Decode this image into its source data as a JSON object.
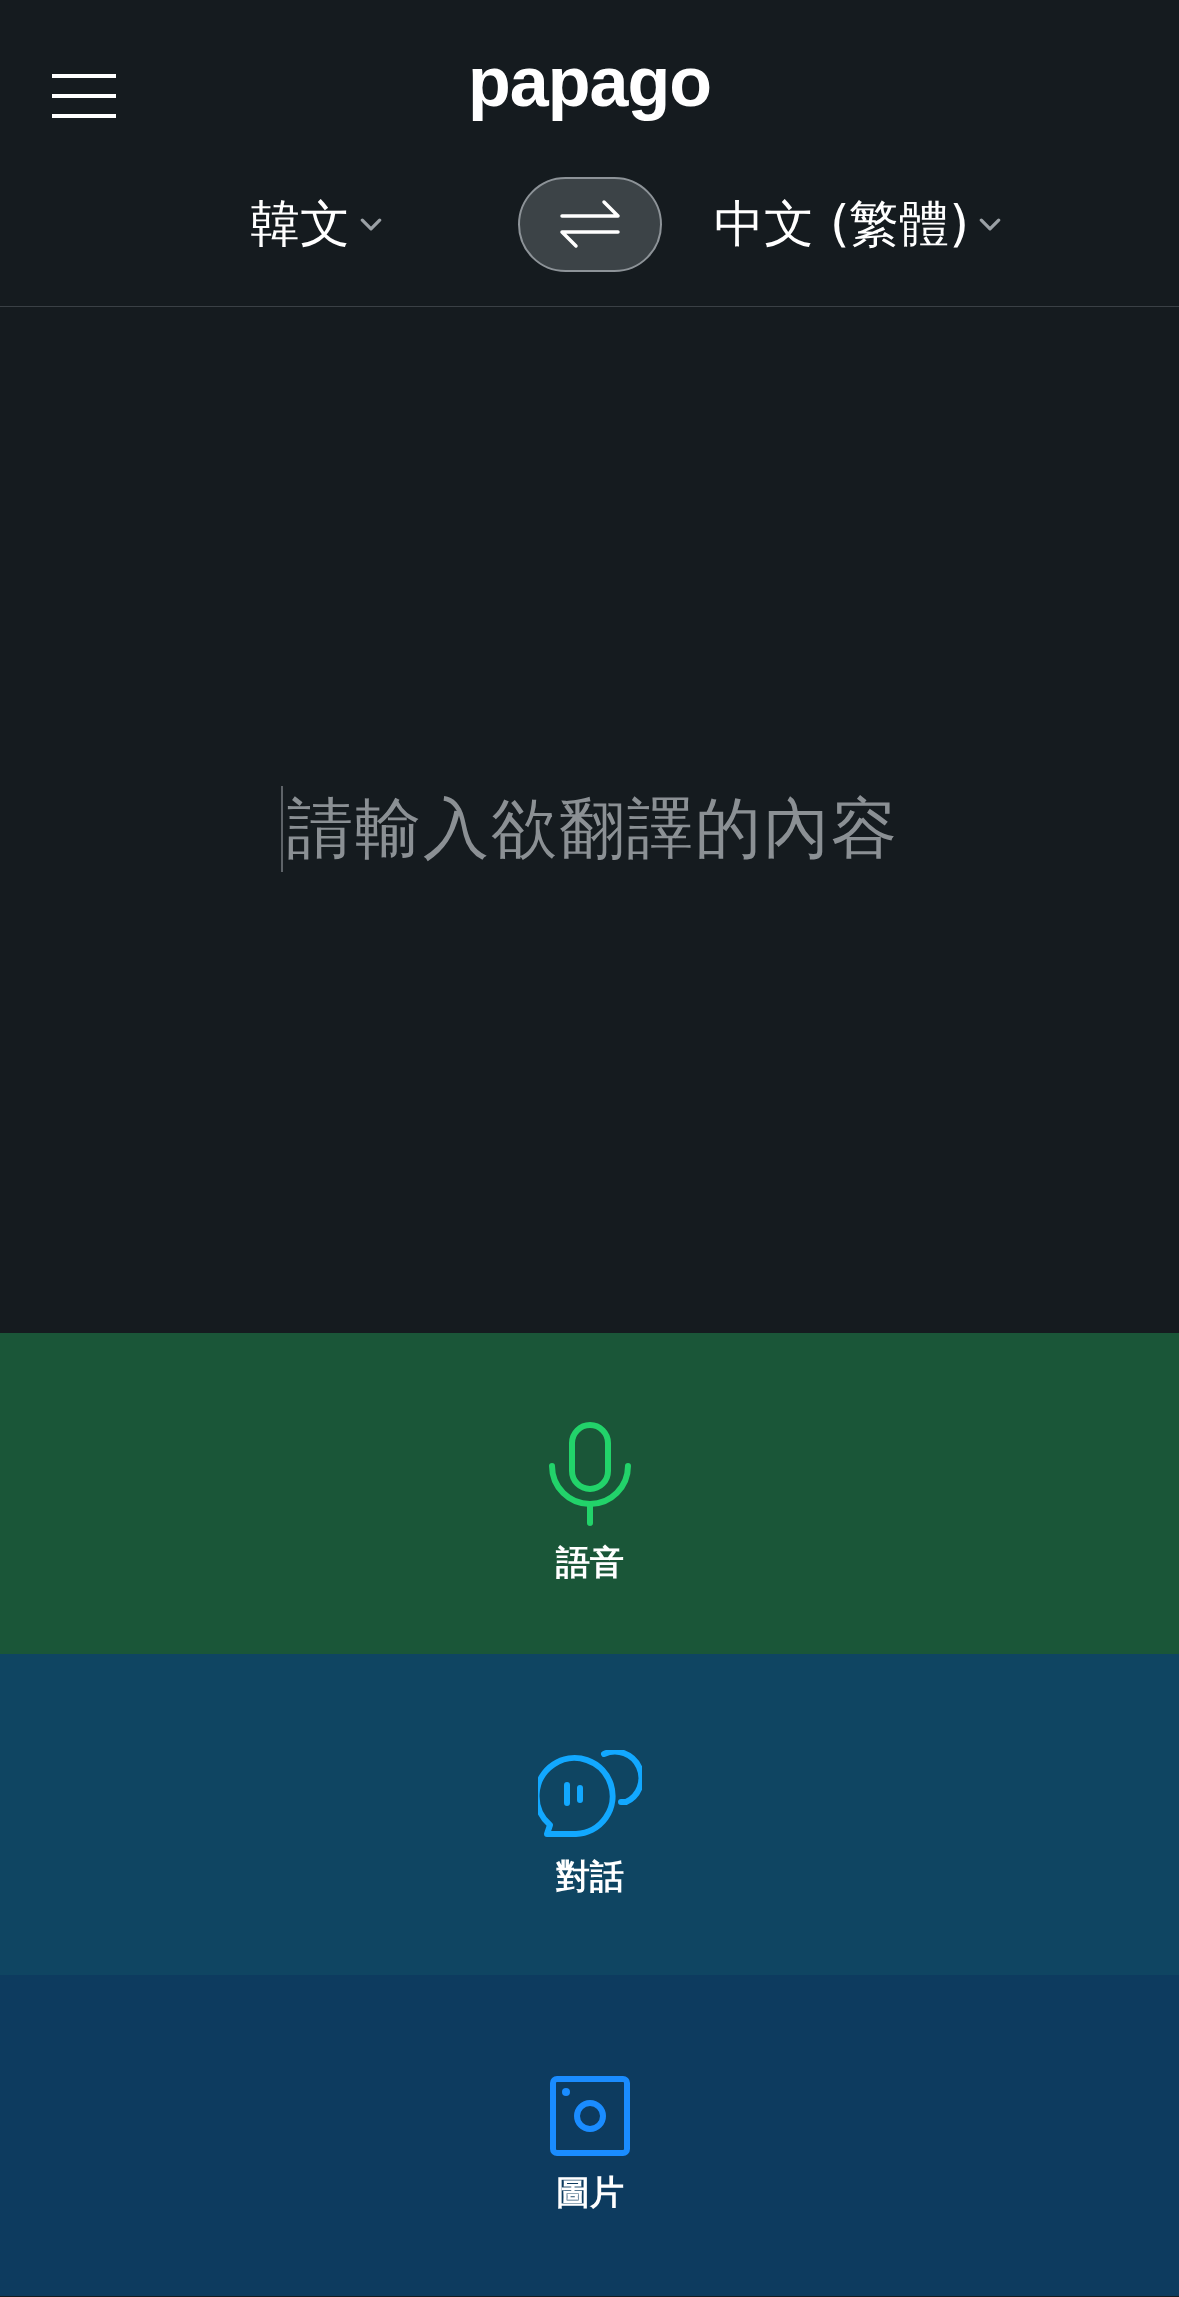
{
  "header": {
    "logo": "papago",
    "source_language": "韓文",
    "target_language": "中文 (繁體)"
  },
  "input": {
    "placeholder": "請輸入欲翻譯的內容"
  },
  "modes": [
    {
      "kind": "voice",
      "label": "語音",
      "color": "#1a5638"
    },
    {
      "kind": "conversation",
      "label": "對話",
      "color": "#0f4562"
    },
    {
      "kind": "image",
      "label": "圖片",
      "color": "#0d3b5f"
    }
  ]
}
